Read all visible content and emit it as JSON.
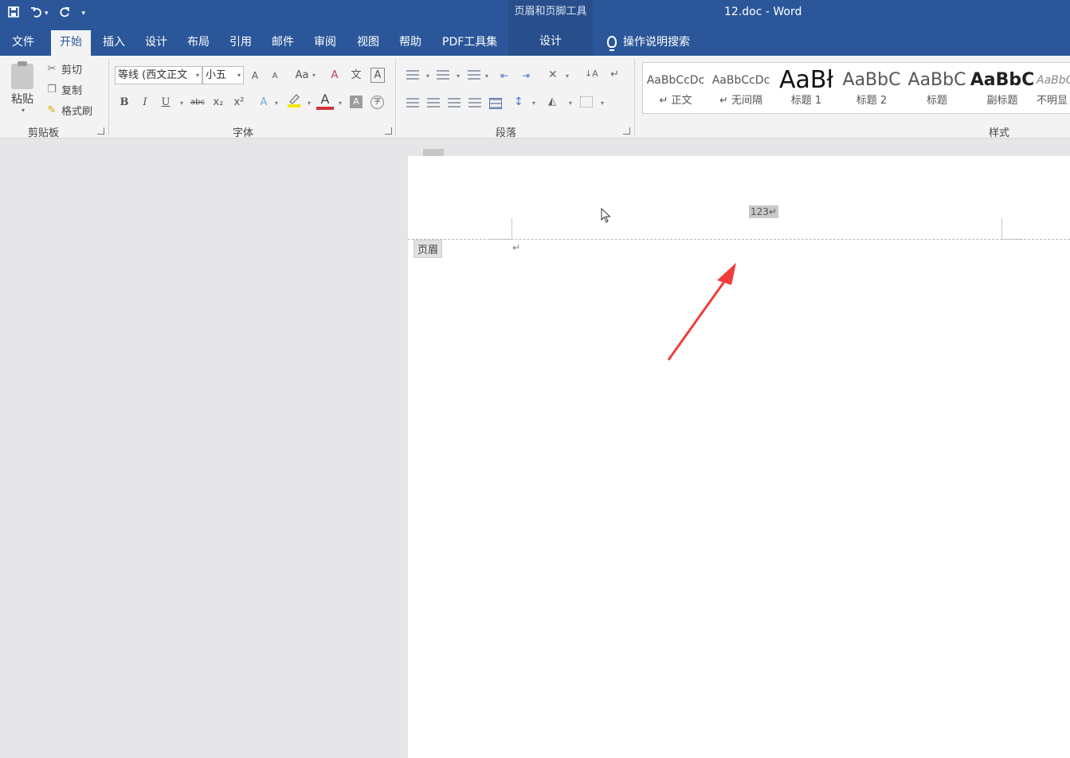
{
  "title_bar": {
    "qat_icons": [
      "save-icon",
      "undo-icon",
      "redo-icon",
      "customize-icon"
    ],
    "context_group": "页眉和页脚工具",
    "document_title": "12.doc  -  Word"
  },
  "tabs": [
    {
      "label": "文件",
      "name": "tab-file"
    },
    {
      "label": "开始",
      "name": "tab-home",
      "active": true
    },
    {
      "label": "插入",
      "name": "tab-insert"
    },
    {
      "label": "设计",
      "name": "tab-design"
    },
    {
      "label": "布局",
      "name": "tab-layout"
    },
    {
      "label": "引用",
      "name": "tab-references"
    },
    {
      "label": "邮件",
      "name": "tab-mailings"
    },
    {
      "label": "审阅",
      "name": "tab-review"
    },
    {
      "label": "视图",
      "name": "tab-view"
    },
    {
      "label": "帮助",
      "name": "tab-help"
    },
    {
      "label": "PDF工具集",
      "name": "tab-pdf-tools"
    }
  ],
  "context_tab": "设计",
  "search": {
    "label": "操作说明搜索",
    "icon": "lightbulb-icon"
  },
  "clipboard": {
    "paste": "粘贴",
    "cut": "剪切",
    "copy": "复制",
    "format_painter": "格式刷",
    "group_label": "剪贴板"
  },
  "font": {
    "font_name": "等线 (西文正文",
    "font_size": "小五",
    "grow": "A",
    "shrink": "A",
    "change_case": "Aa",
    "bold": "B",
    "italic": "I",
    "underline": "U",
    "strikethrough": "abc",
    "subscript": "x₂",
    "superscript": "x²",
    "text_effects": "A",
    "font_color": "A",
    "char_shading": "A",
    "phonetic": "文",
    "char_border": "A",
    "enclose": "字",
    "group_label": "字体",
    "colors": {
      "highlight": "#f2e600",
      "font_color": "#d13438"
    }
  },
  "paragraph": {
    "group_label": "段落"
  },
  "styles": {
    "items": [
      {
        "sample": "AaBbCcDc",
        "name": "↵ 正文"
      },
      {
        "sample": "AaBbCcDc",
        "name": "↵ 无间隔"
      },
      {
        "sample": "AaBł",
        "name": "标题 1"
      },
      {
        "sample": "AaBbC",
        "name": "标题 2"
      },
      {
        "sample": "AaBbC",
        "name": "标题"
      },
      {
        "sample": "AaBbC",
        "name": "副标题"
      },
      {
        "sample": "AaBbC",
        "name": "不明显"
      }
    ],
    "group_label": "样式"
  },
  "document": {
    "header_text": "123↵",
    "header_tag": "页眉",
    "paragraph_mark": "↵"
  },
  "colors": {
    "accent": "#2b579a",
    "annotation_arrow": "#f03c3c"
  }
}
